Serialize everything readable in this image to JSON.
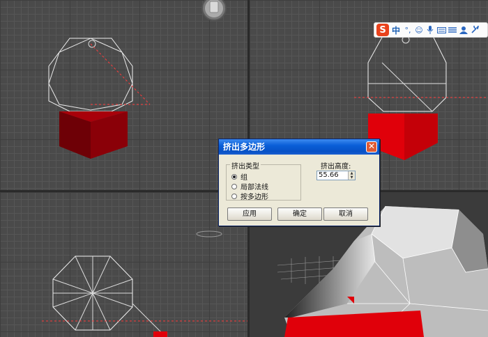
{
  "dialog": {
    "title": "挤出多边形",
    "close_icon": "close-icon",
    "group_label": "挤出类型",
    "radio_options": [
      {
        "label": "组",
        "selected": true
      },
      {
        "label": "局部法线",
        "selected": false
      },
      {
        "label": "按多边形",
        "selected": false
      }
    ],
    "height_label": "挤出高度:",
    "height_value": "55.66",
    "buttons": {
      "apply": "应用",
      "ok": "确定",
      "cancel": "取消"
    }
  },
  "ime_toolbar": {
    "logo": "S",
    "mode": "中",
    "icons": [
      "punctuation-icon",
      "emoji-icon",
      "microphone-icon",
      "keyboard-icon",
      "menu-icon",
      "user-icon",
      "settings-icon"
    ]
  },
  "colors": {
    "selection_red": "#e0000a",
    "dark_red": "#8a0008",
    "viewport_bg": "#4a4a4a",
    "titlebar_blue": "#0a5fd8",
    "dialog_bg": "#ECE9D8"
  }
}
